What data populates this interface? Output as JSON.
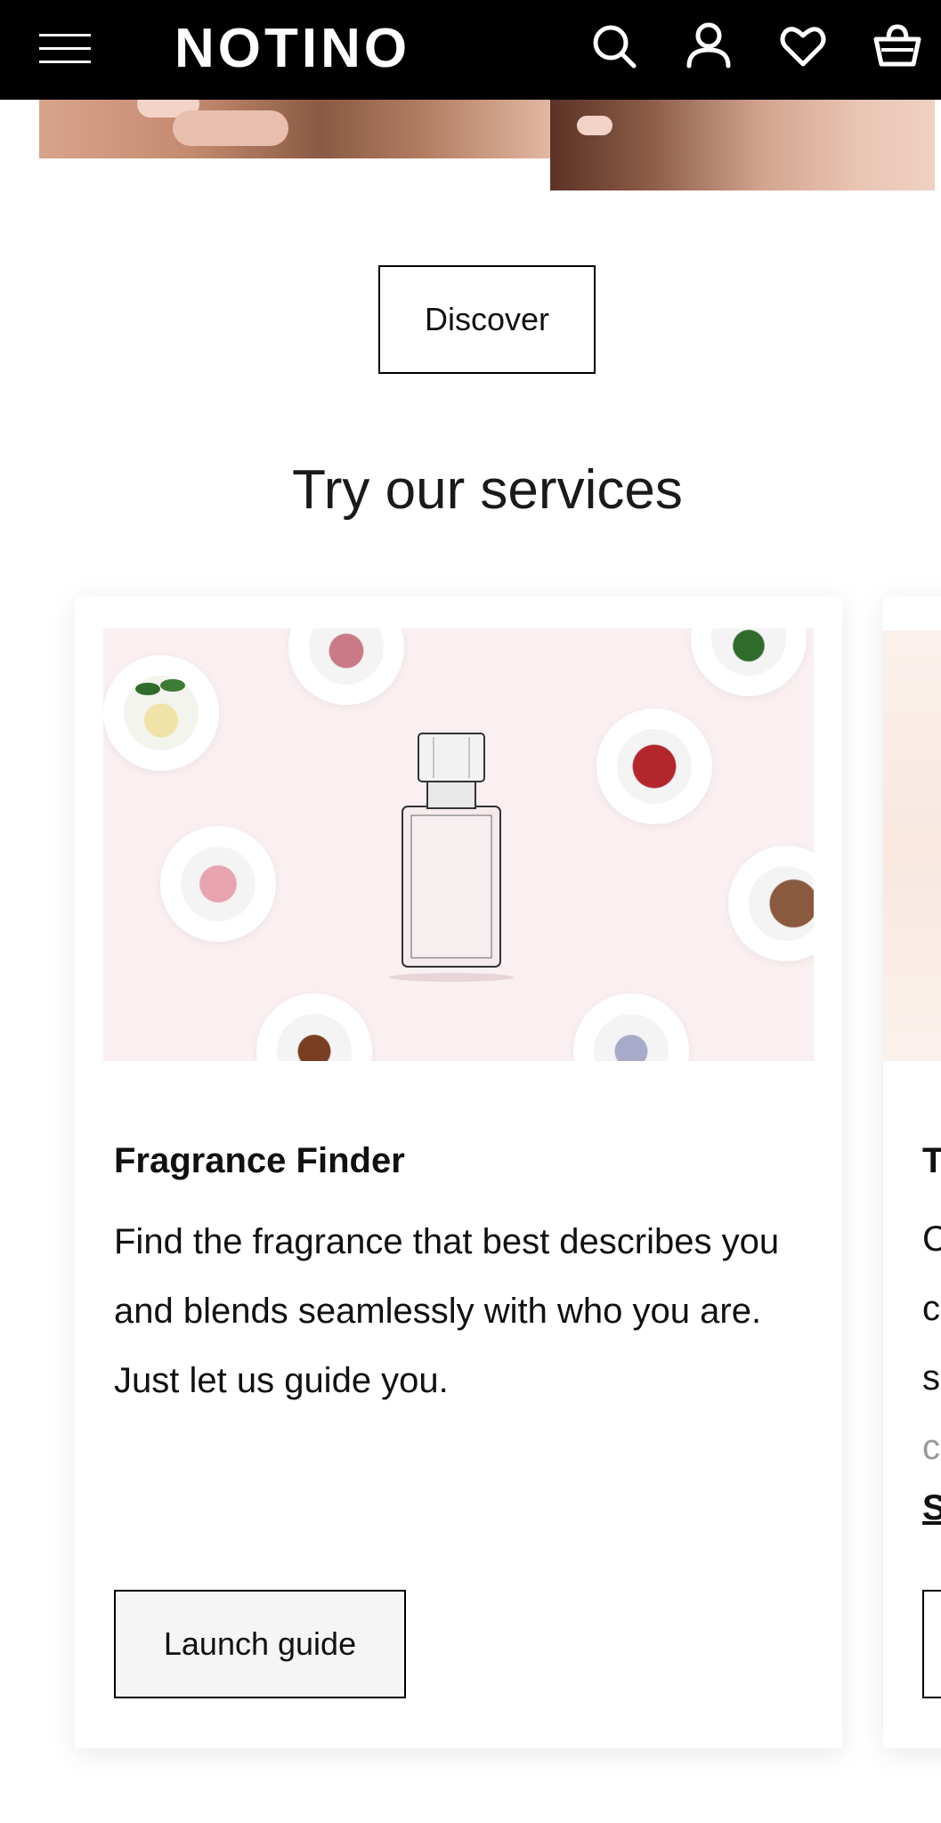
{
  "header": {
    "logo": "NOTINO",
    "menu_icon": "hamburger-menu-icon",
    "search_icon": "search-icon",
    "account_icon": "user-icon",
    "wishlist_icon": "heart-icon",
    "cart_icon": "shopping-bag-icon",
    "background": "#000000"
  },
  "hero": {
    "discover_label": "Discover"
  },
  "services": {
    "title": "Try our services",
    "cards": [
      {
        "title": "Fragrance Finder",
        "description": "Find the fragrance that best describes you and blends seamlessly with who you are. Just let us guide you.",
        "button_label": "Launch guide",
        "image_background": "#faf0f1"
      },
      {
        "title": "T",
        "line1": "C",
        "line2": "c",
        "line3": "s",
        "line4": "c",
        "link": "S"
      }
    ]
  }
}
